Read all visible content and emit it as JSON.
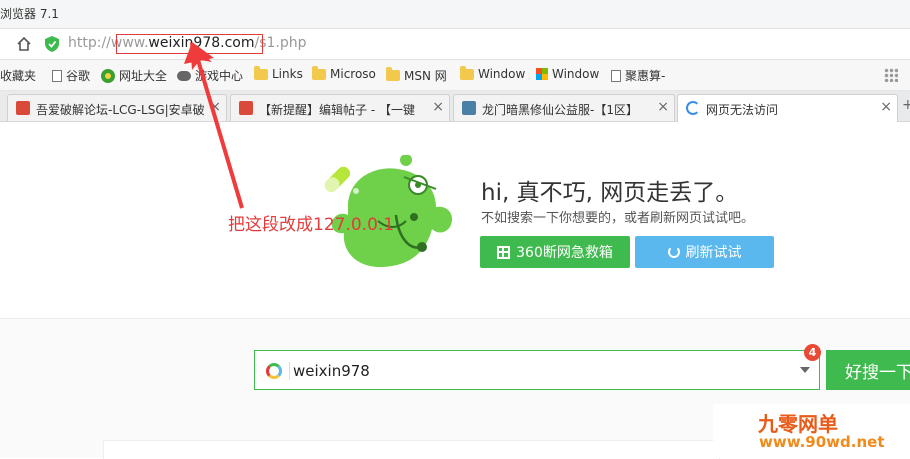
{
  "window": {
    "title": "浏览器 7.1"
  },
  "address_bar": {
    "url_prefix": "http://",
    "url_www": "www.",
    "url_domain": "weixin978.com",
    "url_path": "/s1.php"
  },
  "bookmarks": [
    {
      "label": "收藏夹",
      "icon": "none"
    },
    {
      "label": "谷歌",
      "icon": "page-icon"
    },
    {
      "label": "网址大全",
      "icon": "globe-icon"
    },
    {
      "label": "游戏中心",
      "icon": "gamepad-icon"
    },
    {
      "label": "Links",
      "icon": "folder-icon"
    },
    {
      "label": "Microso",
      "icon": "folder-icon"
    },
    {
      "label": "MSN 网",
      "icon": "folder-icon"
    },
    {
      "label": "Window",
      "icon": "folder-icon"
    },
    {
      "label": "Window",
      "icon": "windows-icon"
    },
    {
      "label": "聚惠算-",
      "icon": "page-icon"
    }
  ],
  "tabs": [
    {
      "title": "吾爱破解论坛-LCG-LSG|安卓破",
      "favicon_color": "#d94a3a",
      "active": false
    },
    {
      "title": "【新提醒】编辑帖子 - 【一键",
      "favicon_color": "#d94a3a",
      "active": false
    },
    {
      "title": "龙门暗黑修仙公益服-【1区】",
      "favicon_color": "#4a7fa8",
      "active": false
    },
    {
      "title": "网页无法访问",
      "favicon_color": "#3b8fe0",
      "active": true
    }
  ],
  "error_page": {
    "title": "hi, 真不巧, 网页走丢了。",
    "subtitle": "不如搜索一下你想要的，或者刷新网页试试吧。",
    "rescue_button": "360断网急救箱",
    "retry_button": "刷新试试"
  },
  "annotation": {
    "text": "把这段改成127.0.0.1",
    "color": "#e23b3b"
  },
  "search": {
    "value": "weixin978",
    "badge_count": "4",
    "button_label": "好搜一下"
  },
  "watermark": {
    "line1": "九零网单",
    "line2": "www.90wd.net"
  },
  "colors": {
    "accent_green": "#3fba4e",
    "accent_blue": "#5bb8ef",
    "annotation_red": "#e23b3b"
  }
}
